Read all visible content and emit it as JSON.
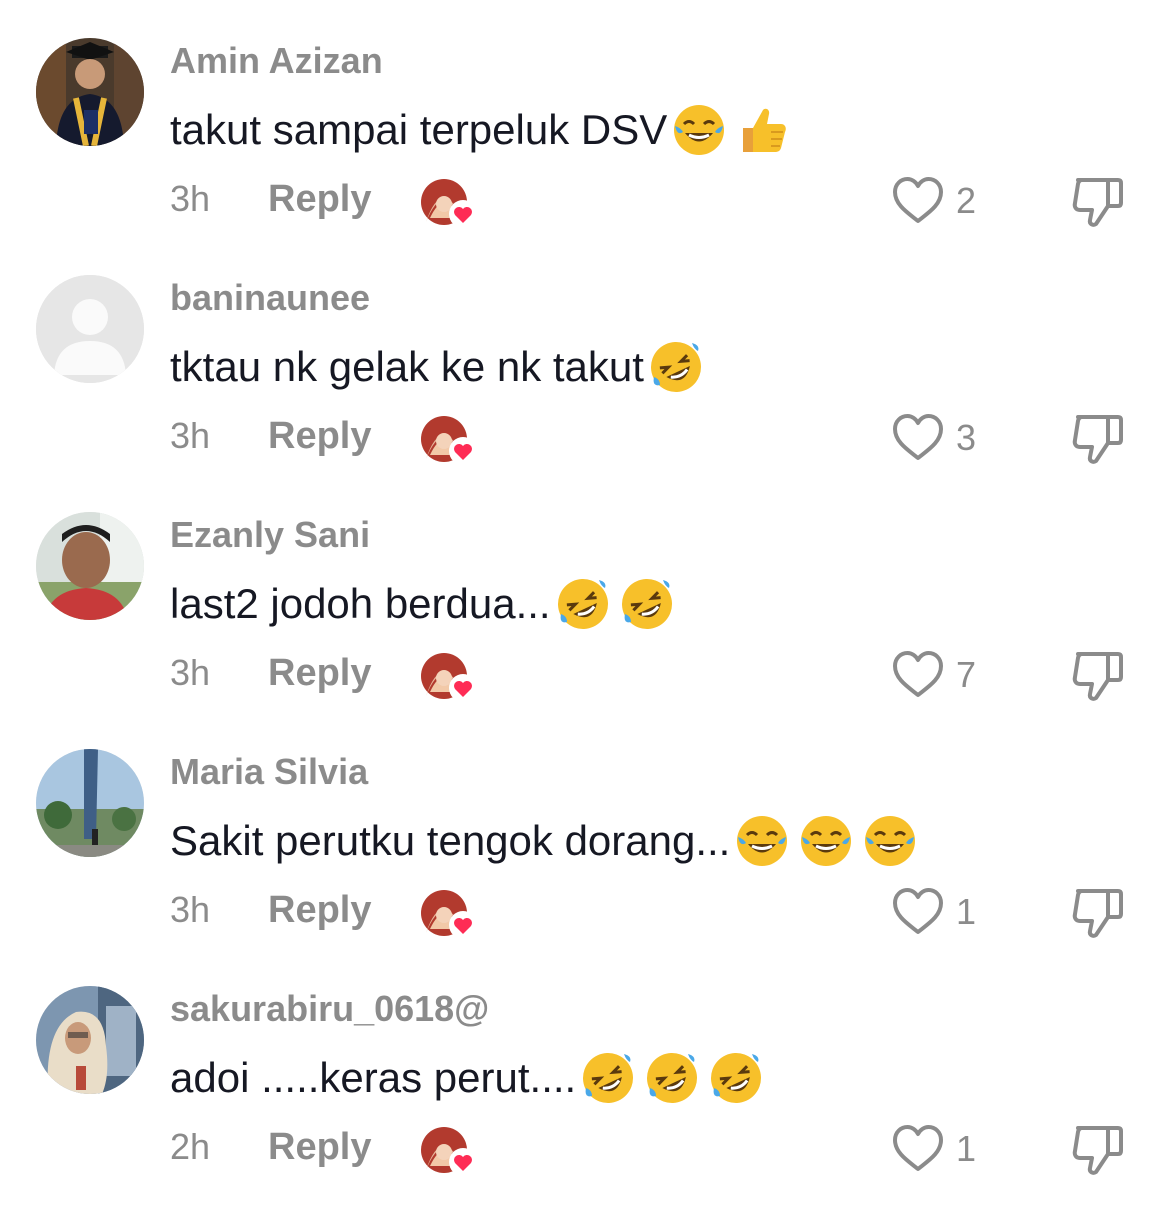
{
  "reply_label": "Reply",
  "accent_like_color": "#fe2c55",
  "comments": [
    {
      "username": "Amin Azizan",
      "text": "takut sampai terpeluk DSV",
      "emojis": [
        "face-with-tears-of-joy",
        "thumbs-up"
      ],
      "time": "3h",
      "likes": "2",
      "avatar": "graduation-photo"
    },
    {
      "username": "baninaunee",
      "text": "tktau nk gelak ke nk takut",
      "emojis": [
        "rolling-on-floor-laughing"
      ],
      "time": "3h",
      "likes": "3",
      "avatar": "default-placeholder"
    },
    {
      "username": "Ezanly Sani",
      "text": "last2 jodoh berdua...",
      "emojis": [
        "rolling-on-floor-laughing",
        "rolling-on-floor-laughing"
      ],
      "time": "3h",
      "likes": "7",
      "avatar": "selfie-photo"
    },
    {
      "username": "Maria Silvia",
      "text": "Sakit perutku tengok dorang... ",
      "emojis": [
        "face-with-tears-of-joy",
        "face-with-tears-of-joy",
        "face-with-tears-of-joy"
      ],
      "time": "3h",
      "likes": "1",
      "avatar": "tower-photo"
    },
    {
      "username": "sakurabiru_0618@",
      "text": "adoi .....keras perut....",
      "emojis": [
        "rolling-on-floor-laughing",
        "rolling-on-floor-laughing",
        "rolling-on-floor-laughing"
      ],
      "time": "2h",
      "likes": "1",
      "avatar": "hijab-photo"
    }
  ]
}
